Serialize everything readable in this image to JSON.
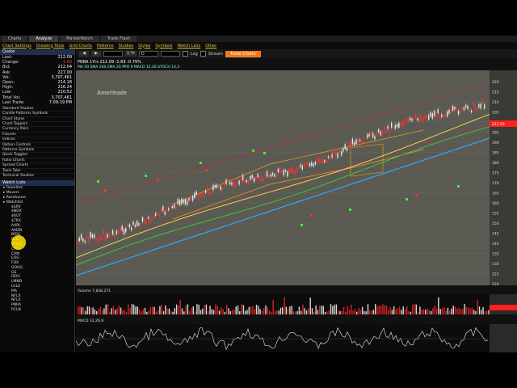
{
  "tabs": [
    "Charts",
    "Analyze",
    "MarketWatch",
    "Trade Flash"
  ],
  "menu": [
    "Chart Settings",
    "Drawing Tools",
    "Grid Charts",
    "Patterns",
    "Studies",
    "Styles",
    "Symbols",
    "Watch Lists",
    "Other"
  ],
  "quote": {
    "header": "Quote",
    "rows": [
      {
        "label": "Last:",
        "value": "212.09",
        "red": false
      },
      {
        "label": "Change:",
        "value": "-1.69",
        "red": true
      },
      {
        "label": "Bid:",
        "value": "212.04",
        "red": false
      },
      {
        "label": "Ask:",
        "value": "227.00",
        "red": false
      },
      {
        "label": "Vol:",
        "value": "3,707,461",
        "red": false
      },
      {
        "label": "Open:",
        "value": "214.18",
        "red": false
      },
      {
        "label": "High:",
        "value": "216.24",
        "red": false
      },
      {
        "label": "Low:",
        "value": "210.52",
        "red": false
      },
      {
        "label": "Total Vol:",
        "value": "3,707,461",
        "red": false
      },
      {
        "label": "Last Trade:",
        "value": "7:09:19 PM",
        "red": false
      }
    ]
  },
  "studies": [
    "Standard Studies",
    "Candle Patterns Symbols",
    "Chart Styles",
    "Chart Toppers",
    "Currency Pairs",
    "Futures",
    "Indices",
    "Option Controls",
    "Patterns Symbols",
    "Quick Toggles",
    "Ratio Charts",
    "Spread Charts",
    "Tools Tabs",
    "Technical Studies"
  ],
  "watchlists": {
    "header": "Watch Lists",
    "groups": [
      "Favorites",
      "Movers",
      "Rosehouse",
      "Watchlist"
    ],
    "symbols": [
      "$SPX",
      "$NDX",
      "$RUT",
      "$TRX",
      "AAPL",
      "AMZN",
      "BIDU",
      "BLK",
      "BWLD",
      "CMG",
      "CRM",
      "EOG",
      "FDX",
      "GOOG",
      "GS",
      "ISRG",
      "LMND",
      "LULU",
      "MA",
      "NFLX",
      "NFLX",
      "PNRA",
      "PCLN"
    ]
  },
  "toolbar": {
    "timeframe": "1 Yr",
    "interval": "D",
    "log_label": "Log",
    "stream_label": "Stream",
    "orange_btn": "Trade Charts"
  },
  "chart": {
    "symbol_line": "PNRA 1Yrs 212.09 -1.69 -0.79%",
    "study_line": "MA 50 SMA 200 EMA 20 PPO 9 MACD 12,26 STOCH 14,3",
    "watermark": "Ameritrade",
    "volume_label": "Volume 7,838,271",
    "osc_label": "MACD 12,26,9",
    "y_ticks": [
      "220",
      "215",
      "210",
      "205",
      "200",
      "195",
      "190",
      "185",
      "180",
      "175",
      "170",
      "165",
      "160",
      "155",
      "150",
      "145",
      "140",
      "135",
      "130",
      "125",
      "120"
    ],
    "price_tag": "212.09",
    "colors": {
      "up": "#e8e8e8",
      "down": "#ff3030",
      "ma_yellow": "#f2e44a",
      "ma_green": "#38c838",
      "ma_blue": "#37a4ff",
      "channel_orange": "#f0a020",
      "price_tag": "#ff2020"
    }
  }
}
